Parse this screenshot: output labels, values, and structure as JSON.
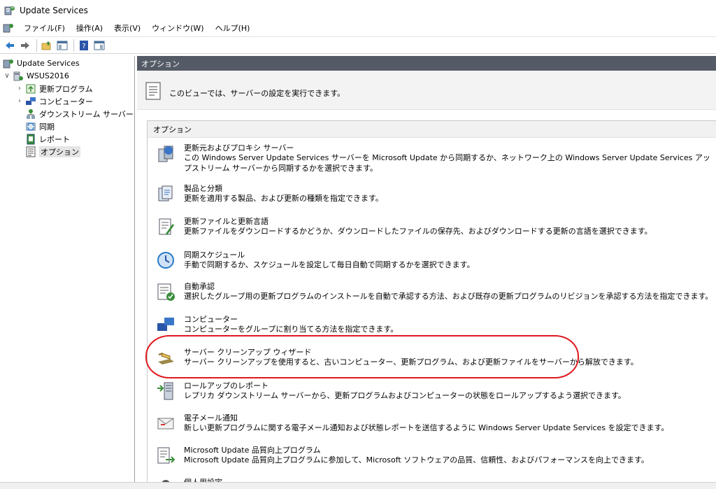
{
  "window": {
    "title": "Update Services"
  },
  "menu": [
    "ファイル(F)",
    "操作(A)",
    "表示(V)",
    "ウィンドウ(W)",
    "ヘルプ(H)"
  ],
  "toolbar": {
    "buttons": [
      "back-icon",
      "forward-icon",
      "up-folder-icon",
      "show-hide-tree-icon",
      "help-icon",
      "action-pane-icon"
    ]
  },
  "tree": {
    "root": "Update Services",
    "server": "WSUS2016",
    "items": [
      {
        "label": "更新プログラム",
        "expandable": true,
        "icon": "updates-icon"
      },
      {
        "label": "コンピューター",
        "expandable": true,
        "icon": "computers-icon"
      },
      {
        "label": "ダウンストリーム サーバー",
        "expandable": false,
        "icon": "downstream-icon"
      },
      {
        "label": "同期",
        "expandable": false,
        "icon": "sync-icon"
      },
      {
        "label": "レポート",
        "expandable": false,
        "icon": "report-icon"
      },
      {
        "label": "オプション",
        "expandable": false,
        "icon": "options-icon",
        "selected": true
      }
    ]
  },
  "main": {
    "header": "オプション",
    "description": "このビューでは、サーバーの設定を実行できます。",
    "section_title": "オプション",
    "options": [
      {
        "title": "更新元およびプロキシ サーバー",
        "desc": "この Windows Server Update Services サーバーを Microsoft Update から同期するか、ネットワーク上の Windows Server Update Services アップストリーム サーバーから同期するかを選択できます。",
        "icon": "proxy-server-icon"
      },
      {
        "title": "製品と分類",
        "desc": "更新を適用する製品、および更新の種類を指定できます。",
        "icon": "products-icon"
      },
      {
        "title": "更新ファイルと更新言語",
        "desc": "更新ファイルをダウンロードするかどうか、ダウンロードしたファイルの保存先、およびダウンロードする更新の言語を選択できます。",
        "icon": "update-files-icon"
      },
      {
        "title": "同期スケジュール",
        "desc": "手動で同期するか、スケジュールを設定して毎日自動で同期するかを選択できます。",
        "icon": "sync-schedule-icon"
      },
      {
        "title": "自動承認",
        "desc": "選択したグループ用の更新プログラムのインストールを自動で承認する方法、および既存の更新プログラムのリビジョンを承認する方法を指定できます。",
        "icon": "auto-approval-icon"
      },
      {
        "title": "コンピューター",
        "desc": "コンピューターをグループに割り当てる方法を指定できます。",
        "icon": "computers-option-icon"
      },
      {
        "title": "サーバー クリーンアップ ウィザード",
        "desc": "サーバー クリーンアップを使用すると、古いコンピューター、更新プログラム、および更新ファイルをサーバーから解放できます。",
        "icon": "cleanup-wizard-icon"
      },
      {
        "title": "ロールアップのレポート",
        "desc": "レプリカ ダウンストリーム サーバーから、更新プログラムおよびコンピューターの状態をロールアップするよう選択できます。",
        "icon": "rollup-icon"
      },
      {
        "title": "電子メール通知",
        "desc": "新しい更新プログラムに関する電子メール通知および状態レポートを送信するように Windows Server Update Services を設定できます。",
        "icon": "email-icon"
      },
      {
        "title": "Microsoft Update 品質向上プログラム",
        "desc": "Microsoft Update 品質向上プログラムに参加して、Microsoft ソフトウェアの品質、信頼性、およびパフォーマンスを向上できます。",
        "icon": "ceip-icon"
      },
      {
        "title": "個人用設定",
        "desc": "",
        "icon": "personalization-icon"
      }
    ]
  },
  "colors": {
    "header_bg": "#555b66",
    "highlight": "#e0191f"
  }
}
